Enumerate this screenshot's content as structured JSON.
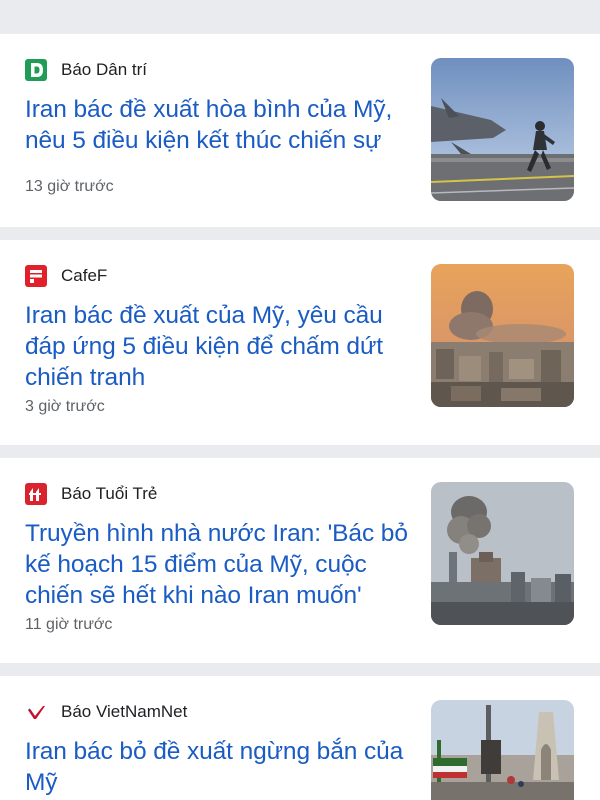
{
  "articles": [
    {
      "source": "Báo Dân trí",
      "logo_icon": "dan-tri-logo-icon",
      "headline": "Iran bác đề xuất hòa bình của Mỹ, nêu 5 điều kiện kết thúc chiến sự",
      "time": "13 giờ trước",
      "thumbnail": "fighter-jet-carrier-image"
    },
    {
      "source": "CafeF",
      "logo_icon": "cafef-logo-icon",
      "headline": "Iran bác đề xuất của Mỹ, yêu cầu đáp ứng 5 điều kiện để chấm dứt chiến tranh",
      "time": "3 giờ trước",
      "thumbnail": "city-smoke-image"
    },
    {
      "source": "Báo Tuổi Trẻ",
      "logo_icon": "tuoi-tre-logo-icon",
      "headline": "Truyền hình nhà nước Iran: 'Bác bỏ kế hoạch 15 điểm của Mỹ, cuộc chiến sẽ hết khi nào Iran muốn'",
      "time": "11 giờ trước",
      "thumbnail": "smoke-over-skyline-image"
    },
    {
      "source": "Báo VietNamNet",
      "logo_icon": "vietnamnet-logo-icon",
      "headline": "Iran bác bỏ đề xuất ngừng bắn của Mỹ",
      "time": "",
      "thumbnail": "azadi-tower-image"
    }
  ],
  "colors": {
    "headline": "#1a5cc4",
    "background": "#e9ebee",
    "dan_tri": "#1f9d57",
    "cafef": "#e0202a",
    "tuoi_tre": "#d9232d",
    "vietnamnet": "#c8102e"
  }
}
